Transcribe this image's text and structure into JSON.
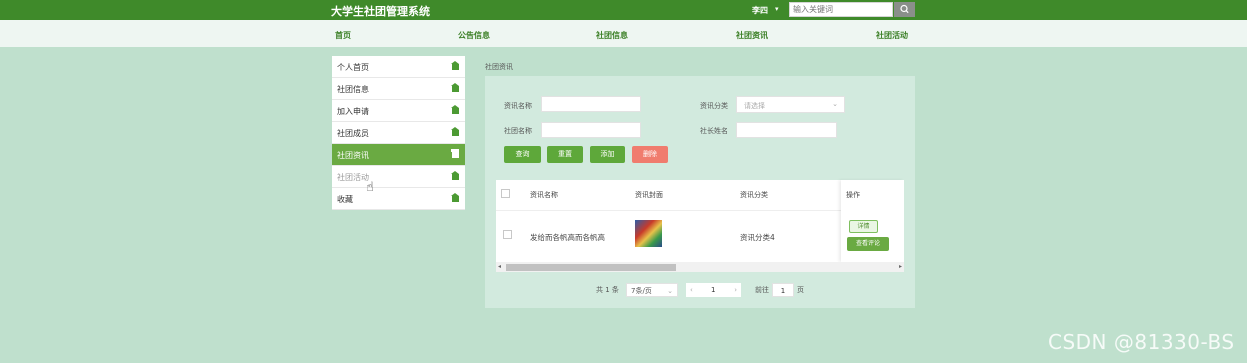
{
  "header": {
    "title": "大学生社团管理系统",
    "user": "李四",
    "user_caret": "▾",
    "search": {
      "placeholder": "输入关键词",
      "icon": "search-icon"
    }
  },
  "nav": [
    "首页",
    "公告信息",
    "社团信息",
    "社团资讯",
    "社团活动"
  ],
  "sidebar": {
    "items": [
      {
        "label": "个人首页",
        "icon": "home-icon"
      },
      {
        "label": "社团信息",
        "icon": "home-icon"
      },
      {
        "label": "加入申请",
        "icon": "home-icon"
      },
      {
        "label": "社团成员",
        "icon": "home-icon"
      },
      {
        "label": "社团资讯",
        "icon": "home-icon",
        "active": true
      },
      {
        "label": "社团活动",
        "icon": "home-icon"
      },
      {
        "label": "收藏",
        "icon": "home-icon"
      }
    ]
  },
  "breadcrumb": "社团资讯",
  "filters": {
    "info_name_label": "资讯名称",
    "info_category_label": "资讯分类",
    "category_placeholder": "请选择",
    "club_name_label": "社团名称",
    "president_label": "社长姓名"
  },
  "buttons": {
    "query": "查询",
    "reset": "重置",
    "add": "添加",
    "delete": "删除"
  },
  "table": {
    "headers": [
      "资讯名称",
      "资讯封面",
      "资讯分类",
      "操作"
    ],
    "rows": [
      {
        "name": "发给而各帆高而各帆高",
        "category": "资讯分类4",
        "detail": "详情",
        "review": "查看评论"
      }
    ]
  },
  "pagination": {
    "total": "共 1 条",
    "page_size": "7条/页",
    "current_page": "1",
    "goto_prefix": "前往",
    "goto_value": "1",
    "goto_suffix": "页",
    "prev": "‹",
    "next": "›"
  },
  "watermark": "CSDN @81330-BS",
  "colors": {
    "header": "#3f8a2a",
    "background": "#bfe0cd",
    "active": "#6aaa42",
    "danger": "#f07c6e"
  }
}
